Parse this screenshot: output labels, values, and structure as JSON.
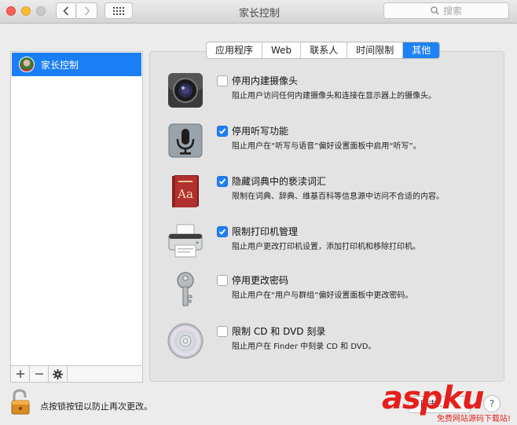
{
  "window": {
    "title": "家长控制"
  },
  "search": {
    "placeholder": "搜索"
  },
  "users": [
    {
      "label": "家长控制"
    }
  ],
  "tabs": [
    {
      "label": "应用程序"
    },
    {
      "label": "Web"
    },
    {
      "label": "联系人"
    },
    {
      "label": "时间限制"
    },
    {
      "label": "其他"
    }
  ],
  "active_tab": "其他",
  "options": [
    {
      "title": "停用内建摄像头",
      "desc": "阻止用户访问任何内建摄像头和连接在显示器上的摄像头。",
      "checked": false,
      "icon": "camera-icon"
    },
    {
      "title": "停用听写功能",
      "desc": "阻止用户在“听写与语音”偏好设置面板中启用“听写”。",
      "checked": true,
      "icon": "microphone-icon"
    },
    {
      "title": "隐藏词典中的亵渎词汇",
      "desc": "限制在词典、辞典、维基百科等信息源中访问不合适的内容。",
      "checked": true,
      "icon": "dictionary-icon"
    },
    {
      "title": "限制打印机管理",
      "desc": "阻止用户更改打印机设置，添加打印机和移除打印机。",
      "checked": true,
      "icon": "printer-icon"
    },
    {
      "title": "停用更改密码",
      "desc": "阻止用户在“用户与群组”偏好设置面板中更改密码。",
      "checked": false,
      "icon": "key-icon"
    },
    {
      "title": "限制 CD 和 DVD 刻录",
      "desc": "阻止用户在 Finder 中刻录 CD 和 DVD。",
      "checked": false,
      "icon": "disc-icon"
    }
  ],
  "footer": {
    "lock_text": "点按锁按钮以防止再次更改。",
    "button_label": "日志...",
    "help_label": "?"
  },
  "watermark": {
    "main": "aspku",
    "sub": "免费网站源码下载站!"
  },
  "colors": {
    "accent": "#1e82f7",
    "watermark": "#e4201d"
  }
}
